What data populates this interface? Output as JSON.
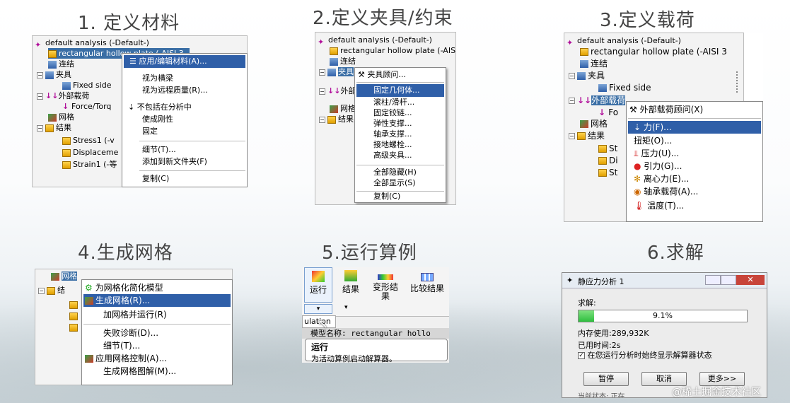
{
  "headings": {
    "h1": "1. 定义材料",
    "h2": "2.定义夹具/约束",
    "h3": "3.定义载荷",
    "h4": "4.生成网格",
    "h5": "5.运行算例",
    "h6": "6.求解"
  },
  "p1": {
    "tree": [
      "default analysis (-Default-)",
      "rectangular hollow plate (-AISI 3",
      "连结",
      "夹具",
      "Fixed side",
      "外部载荷",
      "Force/Torq",
      "网格",
      "结果",
      "Stress1 (-v",
      "Displaceme",
      "Strain1 (-等"
    ],
    "menu": [
      "应用/编辑材料(A)...",
      "视为横梁",
      "视为远程质量(R)...",
      "不包括在分析中",
      "使成刚性",
      "固定",
      "细节(T)...",
      "添加到新文件夹(F)",
      "复制(C)"
    ]
  },
  "p2": {
    "tree": [
      "default analysis (-Default-)",
      "rectangular hollow plate (-AISI 3",
      "连结",
      "夹具",
      "外部",
      "网格",
      "结果"
    ],
    "menu": [
      "夹具顾问...",
      "固定几何体...",
      "滚柱/滑杆...",
      "固定铰链...",
      "弹性支撑...",
      "轴承支撑...",
      "接地螺栓...",
      "高级夹具...",
      "全部隐藏(H)",
      "全部显示(S)",
      "复制(C)"
    ]
  },
  "p3": {
    "tree": [
      "default analysis (-Default-)",
      "rectangular hollow plate (-AISI 3",
      "连结",
      "夹具",
      "Fixed side",
      "外部载荷",
      "Fo",
      "网格",
      "结果",
      "St",
      "Di",
      "St"
    ],
    "menu": [
      "外部载荷顾问(X)",
      "力(F)...",
      "扭矩(O)...",
      "压力(U)...",
      "引力(G)...",
      "离心力(E)...",
      "轴承载荷(A)...",
      "温度(T)..."
    ]
  },
  "p4": {
    "tree": [
      "网格",
      "结"
    ],
    "menu": [
      "为网格化简化模型",
      "生成网格(R)...",
      "加网格并运行(R)",
      "失败诊断(D)...",
      "细节(T)...",
      "应用网格控制(A)...",
      "生成网格图解(M)..."
    ]
  },
  "p5": {
    "buttons": [
      "运行",
      "结果",
      "变形结果",
      "比较结果"
    ],
    "tab": "ulation",
    "status": "模型名称: rectangular hollo",
    "tip_title": "运行",
    "tip_text": "为活动算例启动解算器。"
  },
  "p6": {
    "title": "静应力分析 1",
    "label": "求解:",
    "percent": "9.1%",
    "progress": 0.091,
    "mem": "内存使用:289,932K",
    "time": "已用时间:2s",
    "check": "在您运行分析时始终显示解算器状态",
    "buttons": [
      "暂停",
      "取消",
      "更多>>"
    ],
    "bottom": "当前状态: 正在..."
  },
  "watermark": "@稀土掘金技术社区",
  "colors": {
    "select": "#2f5fa8",
    "progress": "#2fbf3f"
  }
}
